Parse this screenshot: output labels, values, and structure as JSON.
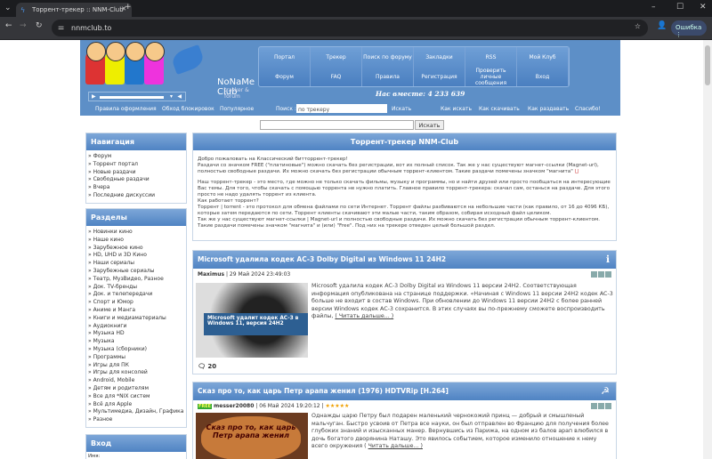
{
  "browser": {
    "tab_title": "Торрент-трекер :: NNM-Club",
    "url": "nnmclub.to",
    "profile_button": "Ошибка"
  },
  "logo": {
    "title": "NoNaMe Club",
    "subtitle": "tracker & forum"
  },
  "topnav": [
    "Портал",
    "Трекер",
    "Поиск по форуму",
    "Закладки",
    "RSS",
    "Мой Клуб",
    "Форум",
    "FAQ",
    "Правила",
    "Регистрация",
    "Проверить личные сообщения",
    "Вход"
  ],
  "together": "Нас вместе: 4 233 639",
  "toolbar": {
    "links_left": [
      "Правила оформления",
      "Обход блокировок",
      "Популярное"
    ],
    "search_label": "Поиск :",
    "search_value": "по трекеру",
    "search_button": "Искать",
    "links_right": [
      "Как искать",
      "Как скачивать",
      "Как раздавать",
      "Спасибо!"
    ]
  },
  "search": {
    "value": "",
    "button": "Искать"
  },
  "sidebar": {
    "nav_title": "Навигация",
    "nav_items": [
      "» Форум",
      "» Торрент портал",
      "» Новые раздачи",
      "» Свободные раздачи",
      "» Вчера",
      "» Последние дискуссии"
    ],
    "sections_title": "Разделы",
    "sections": [
      "» Новинки кино",
      "» Наше кино",
      "» Зарубежное кино",
      "» HD, UHD и 3D Кино",
      "» Наши сериалы",
      "» Зарубежные сериалы",
      "» Театр, МузВидео, Разное",
      "» Док. TV-бренды",
      "» Док. и телепередачи",
      "» Спорт и Юмор",
      "» Аниме и Манга",
      "» Книги и медиаматериалы",
      "» Аудиокниги",
      "» Музыка HD",
      "» Музыка",
      "» Музыка (сборники)",
      "» Программы",
      "» Игры для ПК",
      "» Игры для консолей",
      "» Android, Mobile",
      "» Детям и родителям",
      "» Все для *NIX систем",
      "» Всё для Apple",
      "» Мультимедиа, Дизайн, Графика",
      "» Разное"
    ],
    "login_title": "Вход",
    "login_name_label": "Имя:"
  },
  "main": {
    "title": "Торрент-трекер NNM-Club",
    "intro": [
      "Добро пожаловать на Классический битторрент-трекер!",
      "Раздачи со значком FREE (\"платиновые\") можно скачать без регистрации, вот их полный список. Так же у нас существуют магнет-ссылки (Magnet-url), полностью свободные раздачи. Их можно скачать без регистрации обычным торрент-клиентом. Такие раздачи помечены значком \"магнита\"",
      "Наш торрент-трекер - это место, где можно не только скачать фильмы, музыку и программы, но и найти друзей или просто пообщаться на интересующие Вас темы. Для того, чтобы скачать с помощью торрента не нужно платить. Главное правило торрент-трекера: скачал сам, останься на раздаче. Для этого просто не надо удалять торрент из клиента.",
      "Как работает торрент?",
      "Торрент | torrent - это протокол для обмена файлами по сети Интернет. Торрент файлы разбиваются на небольшие части (как правило, от 16 до 4096 КБ), которые затем передаются по сети. Торрент клиенты скачивают эти малые части, таким образом, собирая исходный файл целиком.",
      "Так же у нас существуют магнет-ссылки | Magnet-url и полностью свободные раздачи. Их можно скачать без регистрации обычным торрент-клиентом. Такие раздачи помечены значком \"магнита\" и (или) \"Free\". Под них на трекере отведен целый большой раздел."
    ],
    "news": [
      {
        "title": "Microsoft удалила кодек AC-3 Dolby Digital из Windows 11 24H2",
        "author": "Maximus",
        "date": "| 29 Май 2024 23:49:03",
        "image_caption": "Microsoft удалит кодек AC-3 в Windows 11, версия 24H2",
        "text": "Microsoft удалила кодек AC-3 Dolby Digital из Windows 11 версии 24H2. Соответствующая информация опубликована на странице поддержки. «Начиная с Windows 11 версии 24H2 кодек AC-3 больше не входит в состав Windows. При обновлении до Windows 11 версии 24H2 с более ранней версии Windows кодек AC-3 сохранится. В этих случаях вы по-прежнему сможете воспроизводить файлы,",
        "read_more": "( Читать дальше... )",
        "comments": "20"
      },
      {
        "title": "Сказ про то, как царь Петр арапа женил (1976) HDTVRip [H.264]",
        "free": "FREE",
        "author": "messer20080",
        "date": "| 06 Май 2024 19:20:12 |",
        "stars": "★★★★★",
        "image_text": "Сказ про то, как царь Петр арапа женил",
        "text": "Однажды царю Петру был подарен маленький чернокожий принц — добрый и смышленый мальчуган. Быстро усвоив от Петра все науки, он был отправлен во Францию для получения более глубоких знаний и изысканных манер. Вернувшись из Парижа, на одном из балов арап влюбился в дочь богатого дворянина Наташу. Это явилось событием, которое изменило отношение к нему всего окружения (",
        "read_more": "Читать дальше... )"
      }
    ]
  }
}
